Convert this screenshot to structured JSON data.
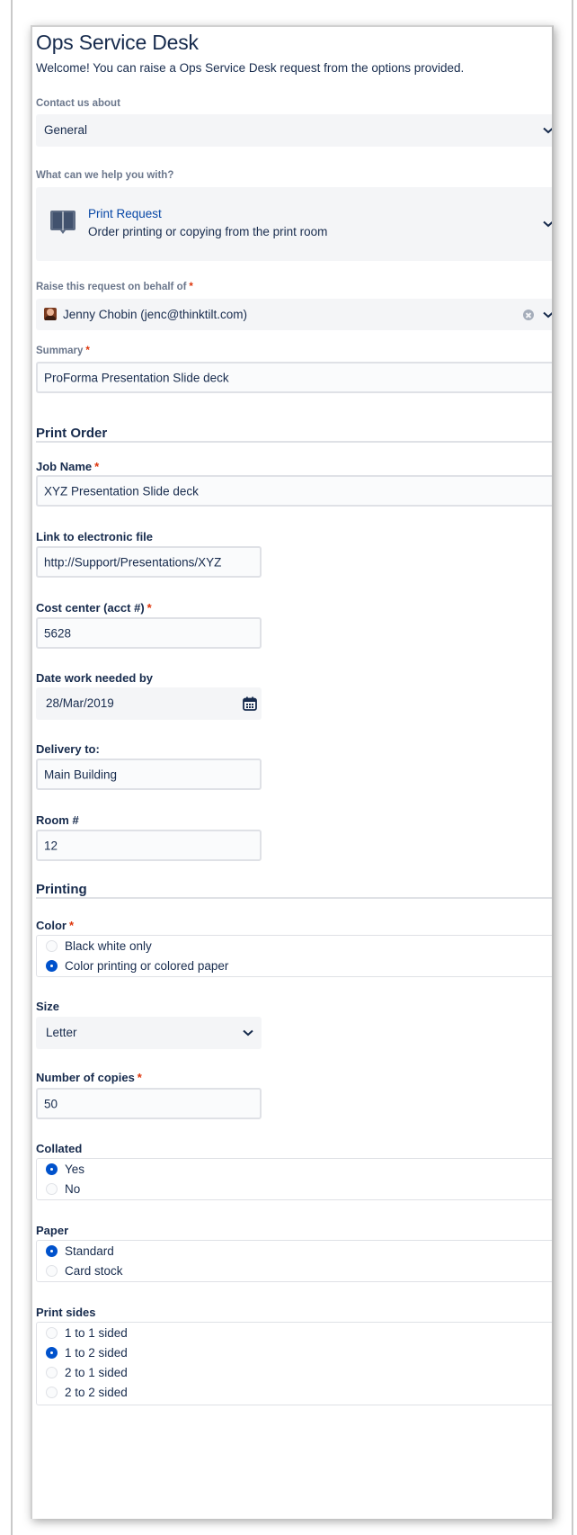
{
  "header": {
    "title": "Ops Service Desk",
    "welcome": "Welcome! You can raise a Ops Service Desk request from the options provided."
  },
  "contact": {
    "label": "Contact us about",
    "value": "General"
  },
  "help": {
    "label": "What can we help you with?",
    "title": "Print Request",
    "description": "Order printing or copying from the print room"
  },
  "behalf": {
    "label": "Raise this request on behalf of",
    "required": "*",
    "value": "Jenny Chobin (jenc@thinktilt.com)"
  },
  "summary": {
    "label": "Summary",
    "required": "*",
    "value": "ProForma Presentation Slide deck"
  },
  "print_order": {
    "heading": "Print Order",
    "job_name": {
      "label": "Job Name",
      "required": "*",
      "value": "XYZ Presentation Slide deck"
    },
    "link": {
      "label": "Link to electronic file",
      "value": "http://Support/Presentations/XYZ"
    },
    "cost_center": {
      "label": "Cost center (acct #)",
      "required": "*",
      "value": "5628"
    },
    "date": {
      "label": "Date work needed by",
      "value": "28/Mar/2019"
    },
    "delivery": {
      "label": "Delivery to:",
      "value": "Main Building"
    },
    "room": {
      "label": "Room #",
      "value": "12"
    }
  },
  "printing": {
    "heading": "Printing",
    "color": {
      "label": "Color",
      "required": "*",
      "options": [
        {
          "label": "Black white only",
          "selected": false
        },
        {
          "label": "Color printing or colored paper",
          "selected": true
        }
      ]
    },
    "size": {
      "label": "Size",
      "value": "Letter"
    },
    "copies": {
      "label": "Number of copies",
      "required": "*",
      "value": "50"
    },
    "collated": {
      "label": "Collated",
      "options": [
        {
          "label": "Yes",
          "selected": true
        },
        {
          "label": "No",
          "selected": false
        }
      ]
    },
    "paper": {
      "label": "Paper",
      "options": [
        {
          "label": "Standard",
          "selected": true
        },
        {
          "label": "Card stock",
          "selected": false
        }
      ]
    },
    "sides": {
      "label": "Print sides",
      "options": [
        {
          "label": "1 to 1 sided",
          "selected": false
        },
        {
          "label": "1 to 2 sided",
          "selected": true
        },
        {
          "label": "2 to 1 sided",
          "selected": false
        },
        {
          "label": "2 to 2 sided",
          "selected": false
        }
      ]
    }
  },
  "colors": {
    "text": "#172b4d",
    "label_muted": "#6b778c",
    "link_blue": "#0747a6",
    "selected_radio": "#0052cc",
    "required_star": "#de350b",
    "field_bg": "#f4f5f7"
  }
}
